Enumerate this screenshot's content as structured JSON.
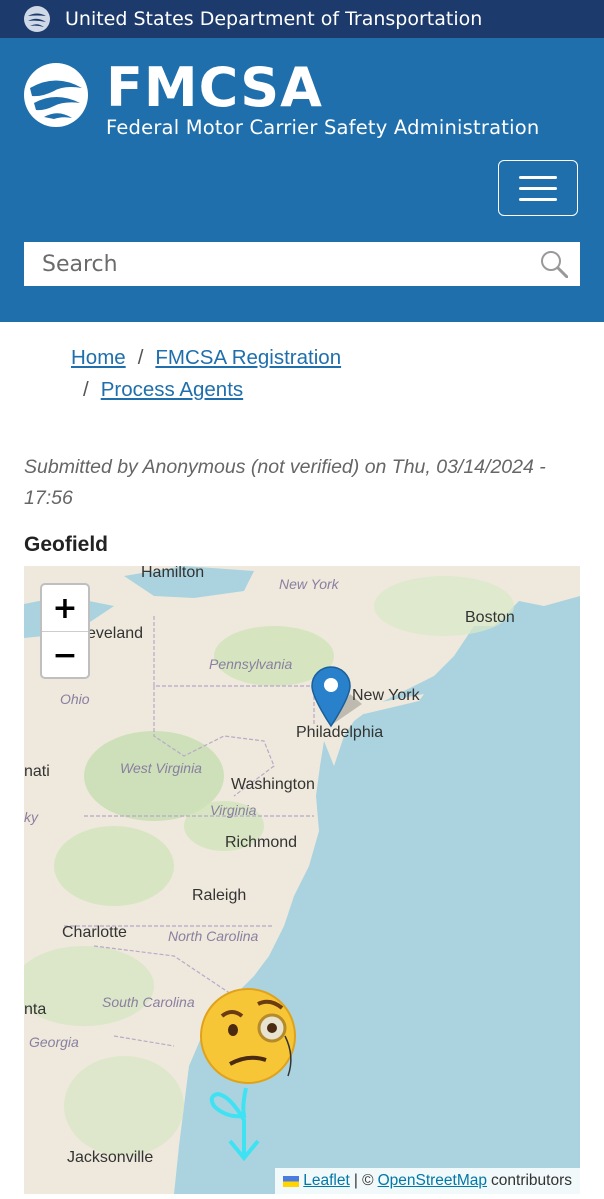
{
  "topbar": {
    "agency": "United States Department of Transportation"
  },
  "header": {
    "acronym": "FMCSA",
    "name": "Federal Motor Carrier Safety Administration",
    "menu_icon": "hamburger-icon"
  },
  "search": {
    "placeholder": "Search",
    "icon": "search-icon"
  },
  "breadcrumb": {
    "separator": "/",
    "items": [
      {
        "label": "Home"
      },
      {
        "label": "FMCSA Registration"
      },
      {
        "label": "Process Agents"
      }
    ]
  },
  "node": {
    "submitted": "Submitted by Anonymous (not verified) on Thu, 03/14/2024 - 17:56",
    "field_label": "Geofield"
  },
  "map": {
    "zoom_in": "+",
    "zoom_out": "−",
    "cities": [
      "Hamilton",
      "eveland",
      "Boston",
      "New York",
      "Philadelphia",
      "nati",
      "Washington",
      "Richmond",
      "Raleigh",
      "Charlotte",
      "nta",
      "Jacksonville"
    ],
    "states": [
      "New York",
      "Pennsylvania",
      "Ohio",
      "West Virginia",
      "Virginia",
      "North Carolina",
      "South Carolina",
      "Georgia",
      "ky"
    ],
    "attribution": {
      "leaflet": "Leaflet",
      "sep": "| ©",
      "osm": "OpenStreetMap",
      "suffix": "contributors"
    },
    "marker_icon": "map-pin-icon",
    "overlay_emoji": "monocle-face-emoji",
    "overlay_arrow": "cyan-arrow-down-icon"
  },
  "colors": {
    "topbar": "#1c3a6b",
    "header": "#1f6fad",
    "link": "#1f6fad",
    "water": "#aad3df",
    "land": "#f2efe9"
  }
}
